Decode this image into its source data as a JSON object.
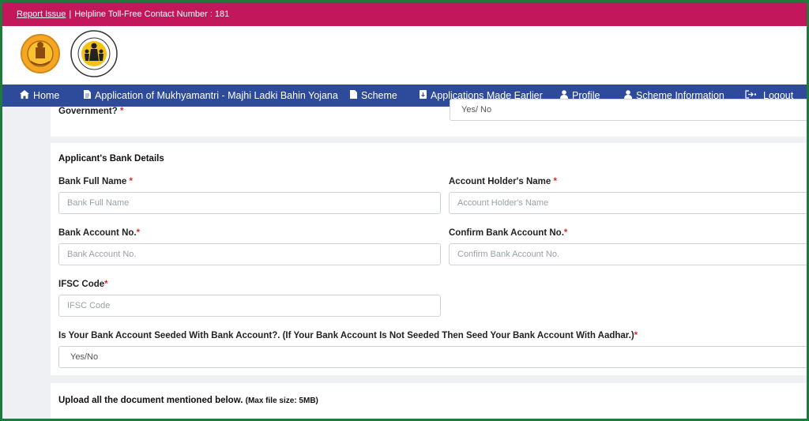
{
  "topbar": {
    "report_issue": "Report Issue",
    "helpline": "Helpline Toll-Free Contact Number : 181"
  },
  "nav": {
    "home": "Home",
    "application": "Application of Mukhyamantri - Majhi Ladki Bahin Yojana",
    "scheme": "Scheme",
    "applications_earlier": "Applications Made Earlier",
    "profile": "Profile",
    "scheme_information": "Scheme Information",
    "logout": "Logout"
  },
  "previous_section": {
    "label_fragment": "Government?",
    "select_value": "Yes/ No"
  },
  "bank_details": {
    "title": "Applicant's Bank Details",
    "bank_full_name_label": "Bank Full Name",
    "bank_full_name_placeholder": "Bank Full Name",
    "account_holder_label": "Account Holder's Name",
    "account_holder_placeholder": "Account Holder's Name",
    "bank_account_no_label": "Bank Account No.",
    "bank_account_no_placeholder": "Bank Account No.",
    "confirm_account_label": "Confirm Bank Account No.",
    "confirm_account_placeholder": "Confirm Bank Account No.",
    "ifsc_label": "IFSC Code",
    "ifsc_placeholder": "IFSC Code",
    "seeded_label": "Is Your Bank Account Seeded With Bank Account?. (If Your Bank Account Is Not Seeded Then Seed Your Bank Account With Aadhar.)",
    "seeded_value": "Yes/No"
  },
  "upload": {
    "title": "Upload all the document mentioned below.",
    "note": "(Max file size: 5MB)"
  },
  "required_mark": "*",
  "colors": {
    "topbar": "#c2185b",
    "nav": "#2e4a9a",
    "border": "#1f7a3c"
  }
}
